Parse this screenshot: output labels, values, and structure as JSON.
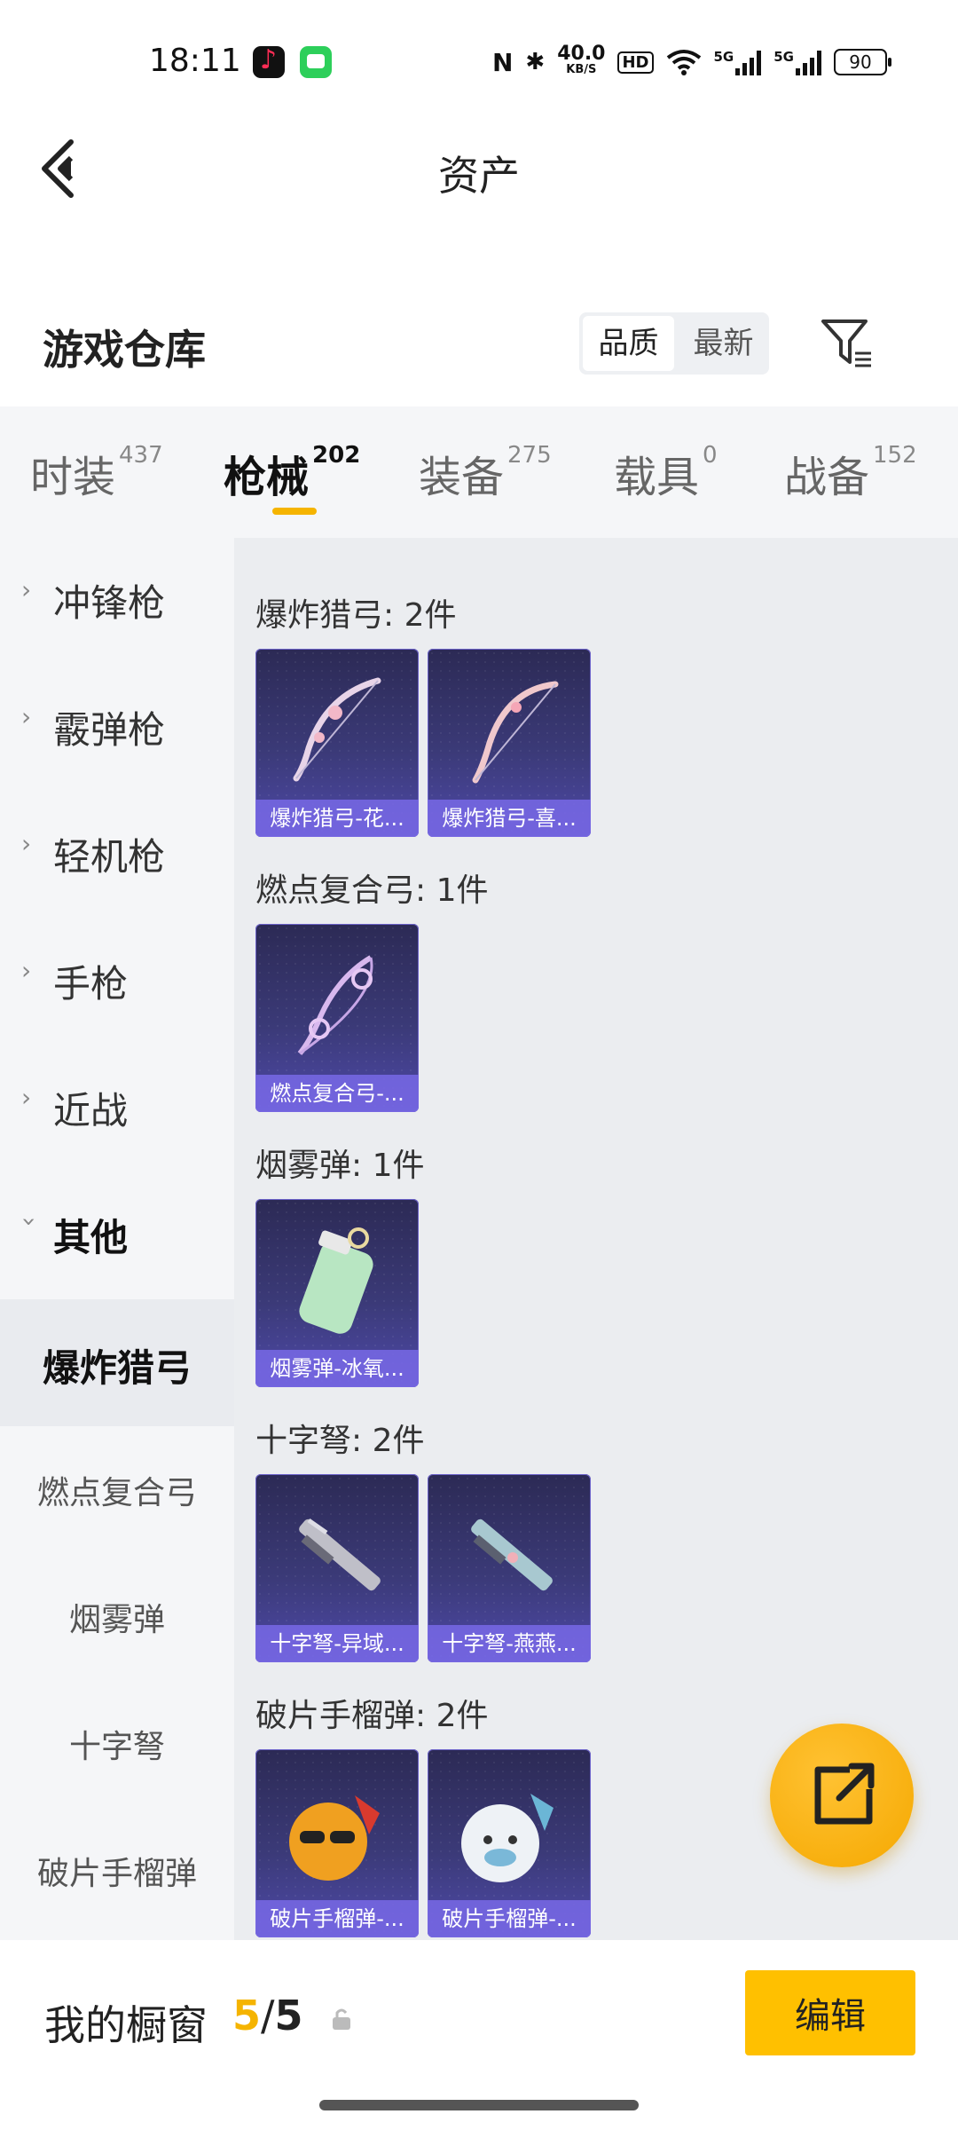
{
  "status_bar": {
    "time": "18:11",
    "speed_value": "40.0",
    "speed_unit": "KB/S",
    "hd": "HD",
    "network1": "5G",
    "network2": "5G",
    "battery": "90"
  },
  "header": {
    "title": "资产",
    "back_icon": "chevron-left-icon"
  },
  "warehouse": {
    "title": "游戏仓库",
    "sort_options": [
      "品质",
      "最新"
    ],
    "sort_active": "品质",
    "filter_icon": "filter-icon"
  },
  "tabs": [
    {
      "label": "时装",
      "count": "437"
    },
    {
      "label": "枪械",
      "count": "202"
    },
    {
      "label": "装备",
      "count": "275"
    },
    {
      "label": "载具",
      "count": "0"
    },
    {
      "label": "战备",
      "count": "152"
    }
  ],
  "active_tab": "枪械",
  "sidebar": {
    "categories": [
      "冲锋枪",
      "霰弹枪",
      "轻机枪",
      "手枪",
      "近战",
      "其他"
    ],
    "expanded": "其他",
    "subitems": [
      "爆炸猎弓",
      "燃点复合弓",
      "烟雾弹",
      "十字弩",
      "破片手榴弹"
    ],
    "active_sub": "爆炸猎弓"
  },
  "groups": [
    {
      "title": "爆炸猎弓: 2件",
      "items": [
        "爆炸猎弓-花...",
        "爆炸猎弓-喜..."
      ]
    },
    {
      "title": "燃点复合弓: 1件",
      "items": [
        "燃点复合弓-..."
      ]
    },
    {
      "title": "烟雾弹: 1件",
      "items": [
        "烟雾弹-冰氧..."
      ]
    },
    {
      "title": "十字弩: 2件",
      "items": [
        "十字弩-异域...",
        "十字弩-燕燕..."
      ]
    },
    {
      "title": "破片手榴弹: 2件",
      "items": [
        "破片手榴弹-...",
        "破片手榴弹-..."
      ]
    }
  ],
  "fab": {
    "icon": "share-external-icon"
  },
  "bottom": {
    "label": "我的橱窗",
    "current": "5",
    "separator": "/",
    "total": "5",
    "lock_icon": "lock-icon",
    "edit_label": "编辑"
  },
  "colors": {
    "accent": "#f5b400",
    "card_bg": "#3b3a78",
    "card_label": "#7869e6"
  }
}
